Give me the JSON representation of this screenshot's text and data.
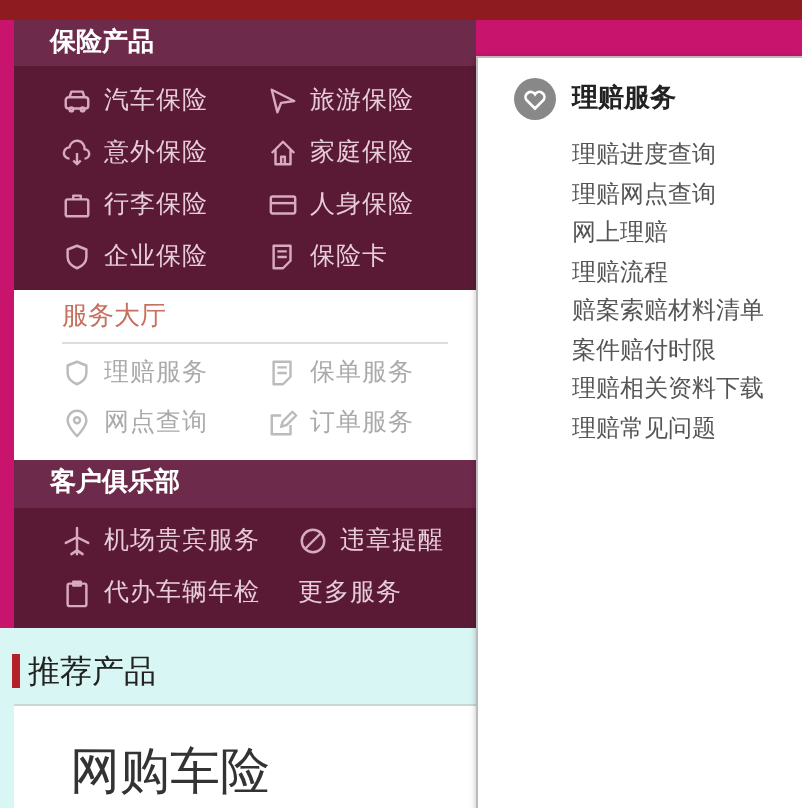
{
  "product_menu": {
    "title": "保险产品",
    "items": [
      {
        "label": "汽车保险"
      },
      {
        "label": "旅游保险"
      },
      {
        "label": "意外保险"
      },
      {
        "label": "家庭保险"
      },
      {
        "label": "行李保险"
      },
      {
        "label": "人身保险"
      },
      {
        "label": "企业保险"
      },
      {
        "label": "保险卡"
      }
    ]
  },
  "service_hall": {
    "title": "服务大厅",
    "items": [
      {
        "label": "理赔服务"
      },
      {
        "label": "保单服务"
      },
      {
        "label": "网点查询"
      },
      {
        "label": "订单服务"
      }
    ]
  },
  "club": {
    "title": "客户俱乐部",
    "items": [
      {
        "label": "机场贵宾服务"
      },
      {
        "label": "违章提醒"
      },
      {
        "label": "代办车辆年检"
      },
      {
        "label": "更多服务"
      }
    ]
  },
  "recommended": {
    "title": "推荐产品",
    "product_title": "网购车险"
  },
  "claims_popup": {
    "title": "理赔服务",
    "links": [
      "理赔进度查询",
      "理赔网点查询",
      "网上理赔",
      "理赔流程",
      "赔案索赔材料清单",
      "案件赔付时限",
      "理赔相关资料下载",
      "理赔常见问题"
    ]
  }
}
